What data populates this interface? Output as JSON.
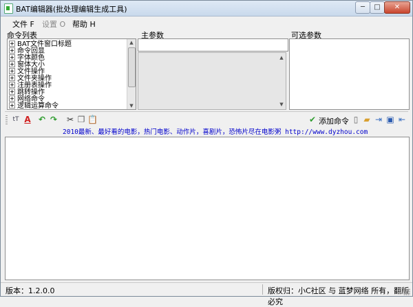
{
  "window": {
    "title": "BAT编辑器(批处理编辑生成工具)",
    "min_glyph": "─",
    "max_glyph": "□",
    "close_glyph": "✕"
  },
  "menu": [
    {
      "label": "文件 F",
      "enabled": true
    },
    {
      "label": "设置 O",
      "enabled": false
    },
    {
      "label": "帮助 H",
      "enabled": true
    }
  ],
  "panels": {
    "commands_label": "命令列表",
    "main_params_label": "主参数",
    "optional_params_label": "可选参数"
  },
  "command_tree": [
    "BAT文件窗口标题",
    "命令回显",
    "字体颜色",
    "窗体大小",
    "文件操作",
    "文件夹操作",
    "注册表操作",
    "跳转操作",
    "网络命令",
    "逻辑运算命令"
  ],
  "toolbar": {
    "add_command_label": "添加命令",
    "icons": [
      "font-size-icon",
      "font-color-icon",
      "undo-icon",
      "redo-icon",
      "cut-icon",
      "copy-icon",
      "paste-icon",
      "checkmark-icon",
      "new-file-icon",
      "open-folder-icon",
      "export-icon",
      "save-icon",
      "exit-icon"
    ]
  },
  "ad_text": "2010最新、最好看的电影，热门电影、动作片，喜剧片，恐怖片尽在电影粥 http://www.dyzhou.com",
  "status": {
    "version": "版本：1.2.0.0",
    "copyright": "版权归：小C社区 与 蓝梦网络 所有，翻版必究"
  },
  "colors": {
    "ad_link": "#0000cc",
    "accent_green": "#2e9c2e",
    "font_red": "#d02020"
  }
}
